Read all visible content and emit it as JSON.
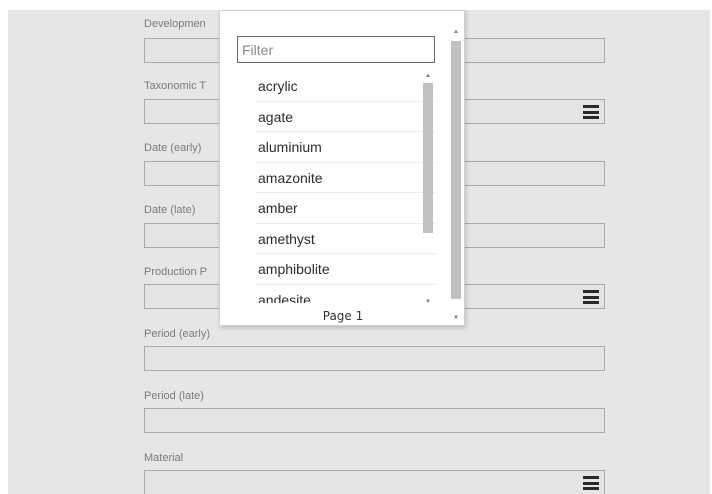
{
  "form": {
    "fields": [
      {
        "label": "Developmen",
        "has_menu": false
      },
      {
        "label": "Taxonomic T",
        "has_menu": true
      },
      {
        "label": "Date (early)",
        "has_menu": false
      },
      {
        "label": "Date (late)",
        "has_menu": false
      },
      {
        "label": "Production P",
        "has_menu": true
      },
      {
        "label": "Period (early)",
        "has_menu": false
      },
      {
        "label": "Period (late)",
        "has_menu": false
      },
      {
        "label": "Material",
        "has_menu": true
      }
    ],
    "menu_icon": "hamburger-menu-icon"
  },
  "dropdown": {
    "filter_placeholder": "Filter",
    "items": [
      "acrylic",
      "agate",
      "aluminium",
      "amazonite",
      "amber",
      "amethyst",
      "amphibolite",
      "andesite"
    ],
    "page_label": "Page 1"
  },
  "colors": {
    "panel_bg": "#e6e6e6",
    "input_border": "#a9a9a9",
    "label": "#7a7a7a"
  }
}
